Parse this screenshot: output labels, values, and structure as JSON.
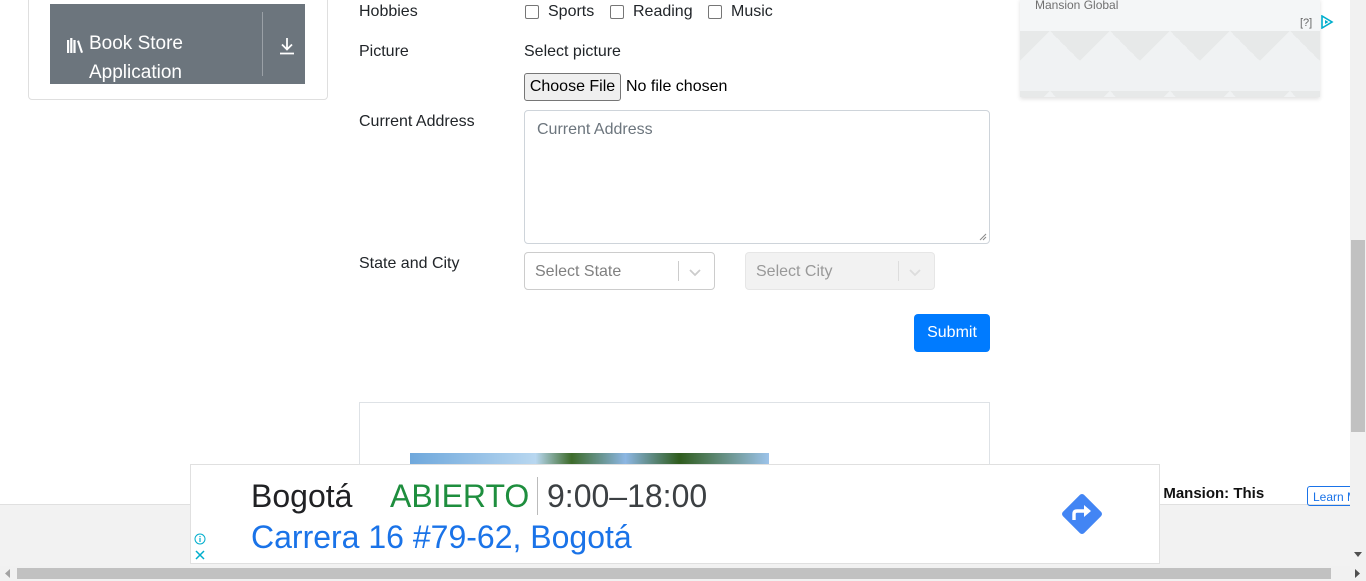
{
  "sidebar": {
    "app_button_label": "Book Store Application",
    "book_icon": "books-icon",
    "download_icon": "download-icon"
  },
  "form": {
    "hobbies_label": "Hobbies",
    "hobbies": [
      {
        "label": "Sports",
        "checked": false
      },
      {
        "label": "Reading",
        "checked": false
      },
      {
        "label": "Music",
        "checked": false
      }
    ],
    "picture_label": "Picture",
    "picture_hint": "Select picture",
    "choose_file_label": "Choose File",
    "no_file_text": "No file chosen",
    "address_label": "Current Address",
    "address_placeholder": "Current Address",
    "state_city_label": "State and City",
    "state_placeholder": "Select State",
    "city_placeholder": "Select City",
    "submit_label": "Submit",
    "accent_color": "#007bff"
  },
  "right_ad": {
    "brand": "Mansion Global",
    "help_text": "[?]",
    "partial_headline": "h Mansion: This",
    "learn_more": "Learn More"
  },
  "bottom_ad": {
    "city": "Bogotá",
    "status": "ABIERTO",
    "hours": "9:00–18:00",
    "address": "Carrera 16 #79-62, Bogotá",
    "status_color": "#1e8e3e",
    "address_color": "#1a73e8"
  }
}
